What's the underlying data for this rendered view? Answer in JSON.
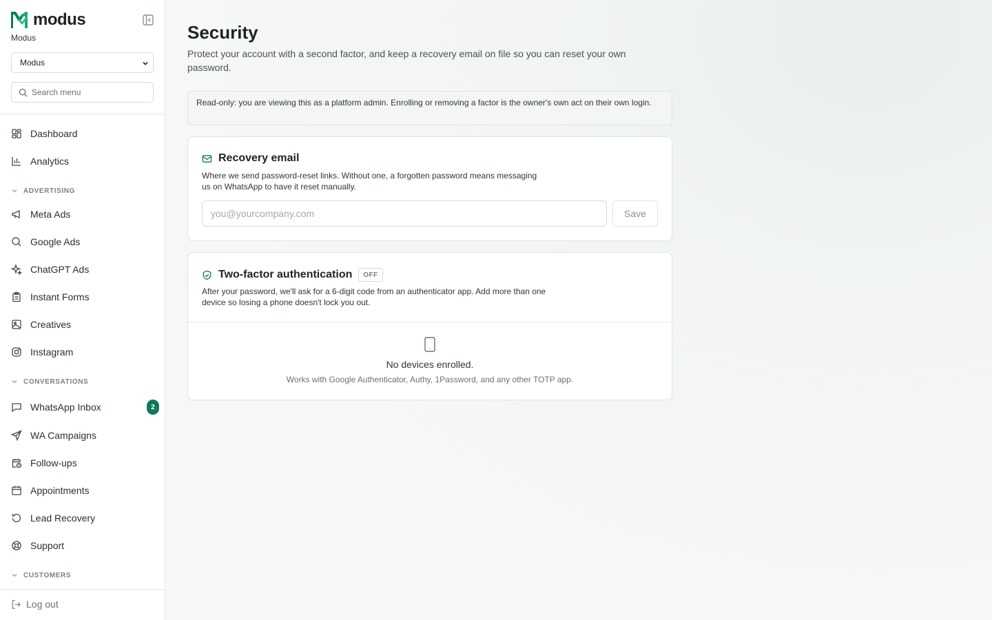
{
  "brand": {
    "name": "modus",
    "org_label": "Modus"
  },
  "org_select": {
    "value": "Modus"
  },
  "search": {
    "placeholder": "Search menu"
  },
  "nav": {
    "dashboard": "Dashboard",
    "analytics": "Analytics",
    "section_advertising": "ADVERTISING",
    "meta_ads": "Meta Ads",
    "google_ads": "Google Ads",
    "chatgpt_ads": "ChatGPT Ads",
    "instant_forms": "Instant Forms",
    "creatives": "Creatives",
    "instagram": "Instagram",
    "section_conversations": "CONVERSATIONS",
    "whatsapp_inbox": "WhatsApp Inbox",
    "whatsapp_inbox_badge": "2",
    "wa_campaigns": "WA Campaigns",
    "follow_ups": "Follow-ups",
    "appointments": "Appointments",
    "lead_recovery": "Lead Recovery",
    "support": "Support",
    "section_customers": "CUSTOMERS",
    "logout": "Log out"
  },
  "page": {
    "title": "Security",
    "subtitle": "Protect your account with a second factor, and keep a recovery email on file so you can reset your own password.",
    "notice": "Read-only: you are viewing this as a platform admin. Enrolling or removing a factor is the owner's own act on their own login."
  },
  "recovery_email": {
    "title": "Recovery email",
    "description": "Where we send password-reset links. Without one, a forgotten password means messaging us on WhatsApp to have it reset manually.",
    "input_placeholder": "you@yourcompany.com",
    "input_value": "",
    "save_label": "Save"
  },
  "two_factor": {
    "title": "Two-factor authentication",
    "status": "OFF",
    "description": "After your password, we'll ask for a 6-digit code from an authenticator app. Add more than one device so losing a phone doesn't lock you out.",
    "empty_title": "No devices enrolled.",
    "empty_subtitle": "Works with Google Authenticator, Authy, 1Password, and any other TOTP app."
  },
  "colors": {
    "brand_green": "#0e7a5a",
    "badge_bg": "#0e7a5a"
  }
}
